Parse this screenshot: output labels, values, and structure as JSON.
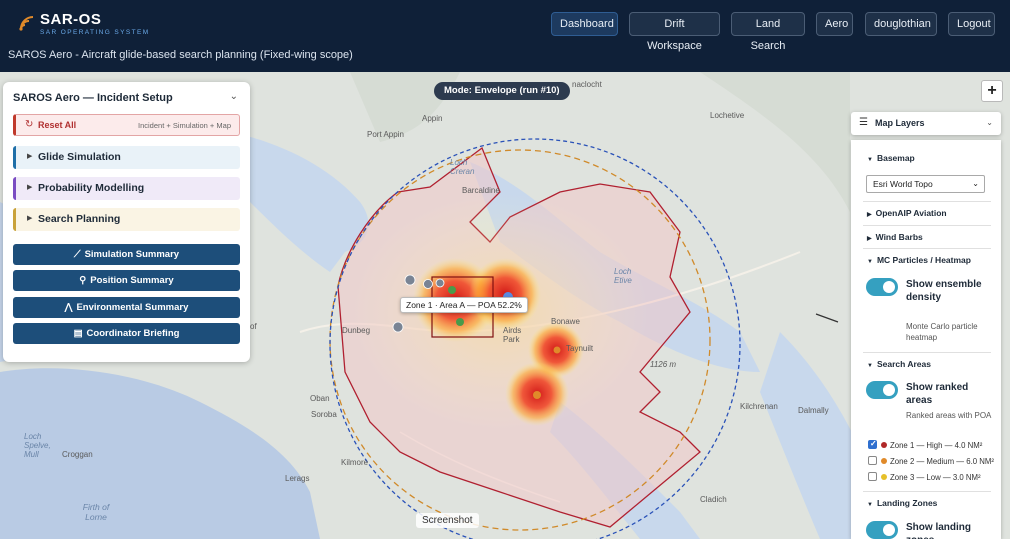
{
  "app": {
    "title": "SAR-OS",
    "tagline": "SAR OPERATING SYSTEM",
    "subtitle": "SAROS Aero - Aircraft glide-based search planning (Fixed-wing scope)"
  },
  "nav": [
    {
      "label": "Dashboard",
      "active": true
    },
    {
      "label": "Drift Workspace"
    },
    {
      "label": "Land Search"
    },
    {
      "label": "Aero"
    },
    {
      "label": "douglothian"
    },
    {
      "label": "Logout"
    }
  ],
  "map": {
    "mode_label": "Mode: Envelope (run #10)",
    "zoom_in": "+",
    "tooltip": "Zone 1 · Area A — POA 52.2%",
    "screenshot_label": "Screenshot",
    "places": [
      {
        "name": "Appin"
      },
      {
        "name": "Port Appin"
      },
      {
        "name": "Loch Creran"
      },
      {
        "name": "Barcaldine"
      },
      {
        "name": "Lochetive"
      },
      {
        "name": "naclocht"
      },
      {
        "name": "Loch Etive"
      },
      {
        "name": "Bonawe"
      },
      {
        "name": "Taynuilt"
      },
      {
        "name": "Airds Park"
      },
      {
        "name": "Dunbeg"
      },
      {
        "name": "Oban"
      },
      {
        "name": "Soroba"
      },
      {
        "name": "Kilmore"
      },
      {
        "name": "Lerags"
      },
      {
        "name": "Loch Spelve, Mull"
      },
      {
        "name": "Croggan"
      },
      {
        "name": "Firth of Lorne"
      },
      {
        "name": "Kilchrenan"
      },
      {
        "name": "Dalmally"
      },
      {
        "name": "Cladich"
      },
      {
        "name": "of"
      },
      {
        "name": "1126 m"
      }
    ]
  },
  "incident_panel": {
    "title": "SAROS Aero — Incident Setup",
    "reset_label": "Reset All",
    "reset_note": "Incident + Simulation + Map",
    "sections": [
      {
        "label": "Glide Simulation",
        "accent": "#1f6fa8",
        "bg": "#e9f2f8"
      },
      {
        "label": "Probability Modelling",
        "accent": "#7a4cc2",
        "bg": "#f0eaf8"
      },
      {
        "label": "Search Planning",
        "accent": "#c9a23a",
        "bg": "#faf4e4"
      }
    ],
    "buttons": [
      {
        "label": "Simulation Summary",
        "icon": "chart-icon",
        "glyph": "⟋"
      },
      {
        "label": "Position Summary",
        "icon": "pin-icon",
        "glyph": "⚲"
      },
      {
        "label": "Environmental Summary",
        "icon": "mountain-icon",
        "glyph": "⋀"
      },
      {
        "label": "Coordinator Briefing",
        "icon": "document-icon",
        "glyph": "▤"
      }
    ]
  },
  "layers_panel": {
    "title": "Map Layers",
    "basemap_label": "Basemap",
    "basemap_value": "Esri World Topo",
    "openaip_label": "OpenAIP Aviation",
    "wind_label": "Wind Barbs",
    "mc_label": "MC Particles / Heatmap",
    "mc_toggle_label": "Show ensemble density",
    "mc_toggle_desc": "Monte Carlo particle heatmap",
    "search_areas_label": "Search Areas",
    "search_toggle_label": "Show ranked areas",
    "search_toggle_desc": "Ranked areas with POA",
    "zones": [
      {
        "label": "Zone 1 — High — 4.0 NM²",
        "checked": true,
        "color": "#b02828"
      },
      {
        "label": "Zone 2 — Medium — 6.0 NM²",
        "checked": false,
        "color": "#e08a2a"
      },
      {
        "label": "Zone 3 — Low — 3.0 NM²",
        "checked": false,
        "color": "#e6c02a"
      }
    ],
    "landing_label": "Landing Zones",
    "landing_toggle_label": "Show landing zones"
  }
}
